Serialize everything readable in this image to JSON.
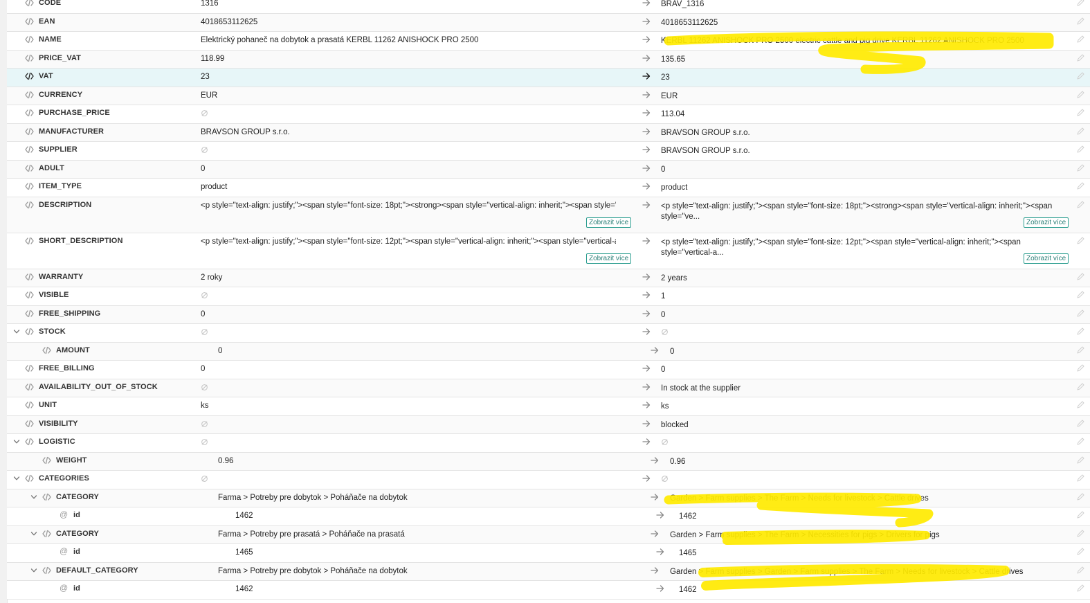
{
  "null_glyph": "empty-set",
  "show_more_label": "Zobrazit více",
  "accent_color": "#2a9d8f",
  "highlight_color": "#ffea00",
  "rows": [
    {
      "key": "CODE",
      "src": "1316",
      "dst": "BRAV_1316",
      "level": 0
    },
    {
      "key": "EAN",
      "src": "4018653112625",
      "dst": "4018653112625",
      "level": 0
    },
    {
      "key": "NAME",
      "src": "Elektrický pohaneč na dobytok a prasatá KERBL 11262 ANISHOCK PRO 2500",
      "dst": "KERBL 11262 ANISHOCK PRO 2500 electric cattle and pig drive KERBL 11262 ANISHOCK PRO 2500",
      "level": 0
    },
    {
      "key": "PRICE_VAT",
      "src": "118.99",
      "dst": "135.65",
      "level": 0
    },
    {
      "key": "VAT",
      "src": "23",
      "dst": "23",
      "level": 0,
      "highlight": true
    },
    {
      "key": "CURRENCY",
      "src": "EUR",
      "dst": "EUR",
      "level": 0
    },
    {
      "key": "PURCHASE_PRICE",
      "src": null,
      "dst": "113.04",
      "level": 0
    },
    {
      "key": "MANUFACTURER",
      "src": "BRAVSON GROUP s.r.o.",
      "dst": "BRAVSON GROUP s.r.o.",
      "level": 0
    },
    {
      "key": "SUPPLIER",
      "src": null,
      "dst": "BRAVSON GROUP s.r.o.",
      "level": 0
    },
    {
      "key": "ADULT",
      "src": "0",
      "dst": "0",
      "level": 0
    },
    {
      "key": "ITEM_TYPE",
      "src": "product",
      "dst": "product",
      "level": 0
    },
    {
      "key": "DESCRIPTION",
      "src": "<p style=\"text-align: justify;\"><span style=\"font-size: 18pt;\"><strong><span style=\"vertical-align: inherit;\"><span style=\"ve...",
      "dst": "<p style=\"text-align: justify;\"><span style=\"font-size: 18pt;\"><strong><span style=\"vertical-align: inherit;\"><span style=\"ve...",
      "level": 0,
      "tall": true
    },
    {
      "key": "SHORT_DESCRIPTION",
      "src": "<p style=\"text-align: justify;\"><span style=\"font-size: 12pt;\"><span style=\"vertical-align: inherit;\"><span style=\"vertical-a...",
      "dst": "<p style=\"text-align: justify;\"><span style=\"font-size: 12pt;\"><span style=\"vertical-align: inherit;\"><span style=\"vertical-a...",
      "level": 0,
      "tall": true
    },
    {
      "key": "WARRANTY",
      "src": "2 roky",
      "dst": "2 years",
      "level": 0
    },
    {
      "key": "VISIBLE",
      "src": null,
      "dst": "1",
      "level": 0
    },
    {
      "key": "FREE_SHIPPING",
      "src": "0",
      "dst": "0",
      "level": 0
    },
    {
      "key": "STOCK",
      "src": null,
      "dst": null,
      "level": 0,
      "expandable": true
    },
    {
      "key": "AMOUNT",
      "src": "0",
      "dst": "0",
      "level": 1
    },
    {
      "key": "FREE_BILLING",
      "src": "0",
      "dst": "0",
      "level": 0
    },
    {
      "key": "AVAILABILITY_OUT_OF_STOCK",
      "src": null,
      "dst": "In stock at the supplier",
      "level": 0
    },
    {
      "key": "UNIT",
      "src": "ks",
      "dst": "ks",
      "level": 0
    },
    {
      "key": "VISIBILITY",
      "src": null,
      "dst": "blocked",
      "level": 0
    },
    {
      "key": "LOGISTIC",
      "src": null,
      "dst": null,
      "level": 0,
      "expandable": true
    },
    {
      "key": "WEIGHT",
      "src": "0.96",
      "dst": "0.96",
      "level": 1
    },
    {
      "key": "CATEGORIES",
      "src": null,
      "dst": null,
      "level": 0,
      "expandable": true
    },
    {
      "key": "CATEGORY",
      "src": "Farma > Potreby pre dobytok > Poháňače na dobytok",
      "dst": "Garden > Farm supplies > The Farm > Needs for livestock > Cattle drives",
      "level": 1,
      "expandable": true
    },
    {
      "key": "id",
      "src": "1462",
      "dst": "1462",
      "level": 2,
      "attr": true
    },
    {
      "key": "CATEGORY",
      "src": "Farma > Potreby pre prasatá > Poháňače na prasatá",
      "dst": "Garden > Farm supplies > The Farm > Necessities for pigs > Drivers for pigs",
      "level": 1,
      "expandable": true
    },
    {
      "key": "id",
      "src": "1465",
      "dst": "1465",
      "level": 2,
      "attr": true
    },
    {
      "key": "DEFAULT_CATEGORY",
      "src": "Farma > Potreby pre dobytok > Poháňače na dobytok",
      "dst": "Garden > Farm supplies > Garden > Farm supplies > The Farm > Needs for livestock > Cattle drives",
      "level": 1,
      "expandable": true
    },
    {
      "key": "id",
      "src": "1462",
      "dst": "1462",
      "level": 2,
      "attr": true
    }
  ]
}
